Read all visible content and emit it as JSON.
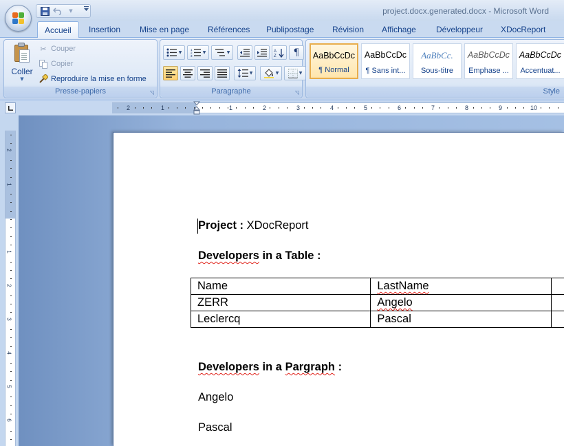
{
  "window": {
    "title": "project.docx.generated.docx - Microsoft Word"
  },
  "quick_access": {
    "items": [
      {
        "name": "save-icon"
      },
      {
        "name": "undo-icon"
      },
      {
        "name": "customize-icon"
      }
    ]
  },
  "tabs": [
    {
      "label": "Accueil",
      "active": true
    },
    {
      "label": "Insertion"
    },
    {
      "label": "Mise en page"
    },
    {
      "label": "Références"
    },
    {
      "label": "Publipostage"
    },
    {
      "label": "Révision"
    },
    {
      "label": "Affichage"
    },
    {
      "label": "Développeur"
    },
    {
      "label": "XDocReport"
    }
  ],
  "ribbon": {
    "clipboard": {
      "paste_label": "Coller",
      "cut_label": "Couper",
      "copy_label": "Copier",
      "format_painter_label": "Reproduire la mise en forme",
      "group_label": "Presse-papiers"
    },
    "paragraph": {
      "group_label": "Paragraphe",
      "active_alignment": "left"
    },
    "styles": {
      "group_label": "Style",
      "items": [
        {
          "sample": "AaBbCcDc",
          "name": "¶ Normal",
          "selected": true
        },
        {
          "sample": "AaBbCcDc",
          "name": "¶ Sans int..."
        },
        {
          "sample": "AaBbCc.",
          "name": "Sous-titre"
        },
        {
          "sample": "AaBbCcDc",
          "name": "Emphase ..."
        },
        {
          "sample": "AaBbCcDc",
          "name": "Accentuat..."
        }
      ]
    }
  },
  "ruler": {
    "horizontal_numbers": [
      "2",
      "1",
      "1",
      "2",
      "3",
      "4",
      "5",
      "6",
      "7",
      "8",
      "9",
      "10"
    ],
    "vertical_numbers": [
      "2",
      "1",
      "1",
      "2",
      "3",
      "4",
      "5",
      "6"
    ]
  },
  "document": {
    "project_label": "Project :",
    "project_value": "XDocReport",
    "table_heading_word": "Developers",
    "table_heading_rest": " in a Table :",
    "table": {
      "headers": [
        "Name",
        "LastName",
        ""
      ],
      "rows": [
        [
          "ZERR",
          "Angelo",
          ""
        ],
        [
          "Leclercq",
          "Pascal",
          ""
        ]
      ]
    },
    "paragraph_heading_word1": "Developers",
    "paragraph_heading_mid": " in a ",
    "paragraph_heading_word2": "Pargraph",
    "paragraph_heading_rest": " :",
    "paragraph_items": [
      "Angelo",
      "Pascal"
    ]
  },
  "colors": {
    "ribbon_text": "#15428b",
    "spelling_error": "#e0241c",
    "selected_style": "#e8ad4c",
    "doc_background": "#97b4dc"
  }
}
